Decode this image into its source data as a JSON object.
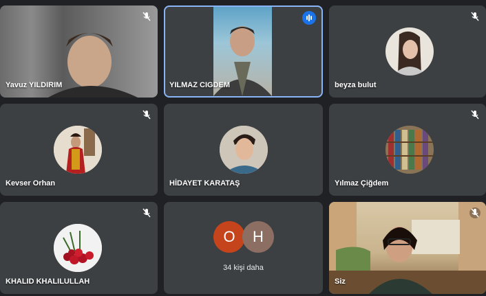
{
  "tiles": [
    {
      "name": "Yavuz YILDIRIM"
    },
    {
      "name": "YILMAZ CIGDEM"
    },
    {
      "name": "beyza bulut"
    },
    {
      "name": "Kevser Orhan"
    },
    {
      "name": "HİDAYET KARATAŞ"
    },
    {
      "name": "Yılmaz Çiğdem"
    },
    {
      "name": "KHALID KHALILULLAH"
    },
    {
      "name": "Siz"
    }
  ],
  "more": {
    "label": "34 kişi daha",
    "initials": [
      "O",
      "H"
    ],
    "colors": [
      "#c5441b",
      "#8d6e63"
    ]
  },
  "colors": {
    "tile_bg": "#3c4043",
    "page_bg": "#202124",
    "active_speaker_outline": "#8ab4f8",
    "speaking_badge": "#1a73e8"
  }
}
